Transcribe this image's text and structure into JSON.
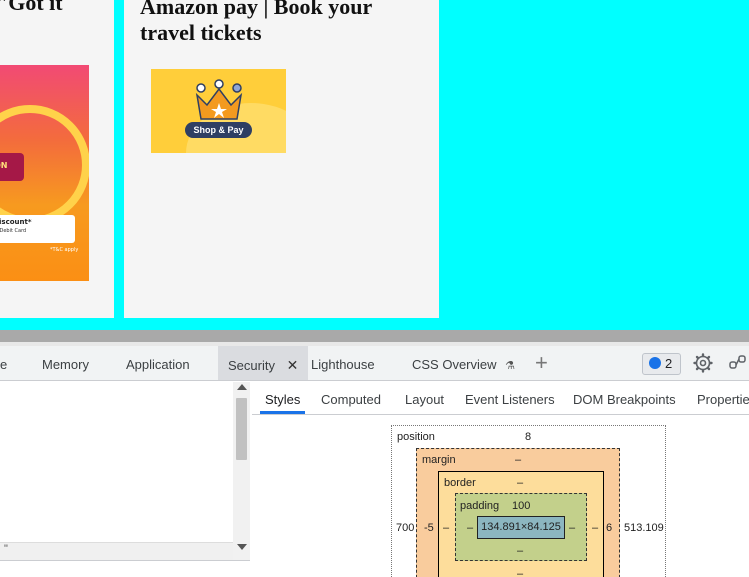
{
  "page": {
    "left_card_title": "\"Got it",
    "right_card_title": "Amazon pay | Book your travel tickets",
    "promo": {
      "badge_text": "ON",
      "discount_line1": "discount*",
      "discount_line2": "& Debit Card",
      "tc_note": "*T&C apply"
    },
    "pay_logo": {
      "pill_label": "Shop & Pay"
    }
  },
  "devtools": {
    "tabs": [
      {
        "label": "e",
        "icon": ""
      },
      {
        "label": "Memory",
        "icon": ""
      },
      {
        "label": "Application",
        "icon": ""
      },
      {
        "label": "Security",
        "icon": "close-icon",
        "active": true
      },
      {
        "label": "Lighthouse",
        "icon": ""
      },
      {
        "label": "CSS Overview",
        "icon": "flask-icon"
      }
    ],
    "close_glyph": "✕",
    "flask_glyph": "⚗",
    "add_tab_glyph": "+",
    "message_count": "2",
    "left_pane": {
      "console_text": "\""
    },
    "sub_tabs": [
      {
        "label": "Styles",
        "active": true
      },
      {
        "label": "Computed"
      },
      {
        "label": "Layout"
      },
      {
        "label": "Event Listeners"
      },
      {
        "label": "DOM Breakpoints"
      },
      {
        "label": "Properties"
      }
    ],
    "box_model": {
      "position_label": "position",
      "position_top": "8",
      "position_left": "700",
      "position_right": "513.109",
      "margin_label": "margin",
      "margin_top": "–",
      "margin_left": "-5",
      "margin_right": "6",
      "border_label": "border",
      "border_top": "–",
      "border_left": "–",
      "border_right": "–",
      "border_bottom": "–",
      "padding_label": "padding",
      "padding_top": "100",
      "padding_left": "–",
      "padding_right": "–",
      "padding_bottom": "–",
      "content_size": "134.891×84.125"
    },
    "colors": {
      "accent": "#1a73e8",
      "margin_bg": "#f9cc9d",
      "border_bg": "#fddd9b",
      "padding_bg": "#c3d08b",
      "content_bg": "#8cb6c0",
      "page_bg": "#00ffff"
    }
  }
}
